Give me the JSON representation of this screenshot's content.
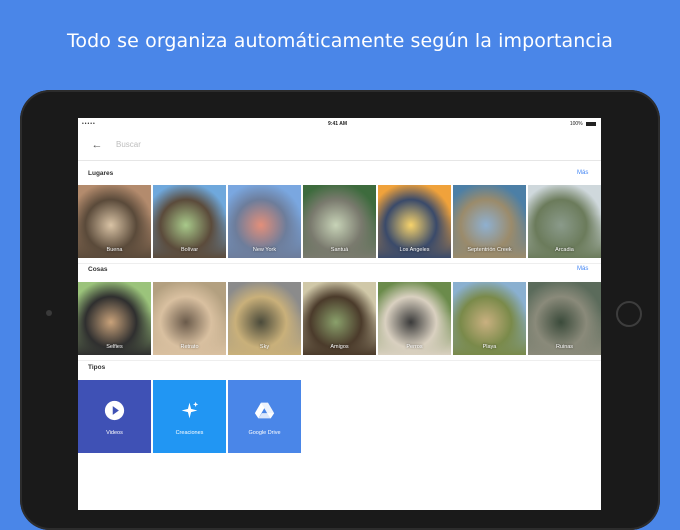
{
  "headline": "Todo se organiza automáticamente según la importancia",
  "status_bar": {
    "signal": "•••••",
    "time": "9:41 AM",
    "battery": "100%"
  },
  "search": {
    "placeholder": "Buscar"
  },
  "sections": {
    "places": {
      "title": "Lugares",
      "more": "Más",
      "items": [
        {
          "label": "Buena",
          "colors": [
            "#b38b6d",
            "#5a4a3a",
            "#d9c3a5"
          ]
        },
        {
          "label": "Bolívar",
          "colors": [
            "#6fa8dc",
            "#5b4b3b",
            "#a8c98a"
          ]
        },
        {
          "label": "New York",
          "colors": [
            "#7aa7e0",
            "#6d7d9b",
            "#e38f7a"
          ]
        },
        {
          "label": "Santuá",
          "colors": [
            "#3d6b3d",
            "#7a7a6e",
            "#c7d3b7"
          ]
        },
        {
          "label": "Los Angeles",
          "colors": [
            "#f0a23b",
            "#3a4a6a",
            "#f7d36b"
          ]
        },
        {
          "label": "Septentrión Creek",
          "colors": [
            "#4c7fa6",
            "#9b8b6b",
            "#8fb0d0"
          ]
        },
        {
          "label": "Arcadia",
          "colors": [
            "#cfd8dc",
            "#6b7b5b",
            "#8a9a8a"
          ]
        }
      ]
    },
    "things": {
      "title": "Cosas",
      "more": "Más",
      "items": [
        {
          "label": "Selfies",
          "colors": [
            "#9bc37b",
            "#2f2f2f",
            "#c9a27a"
          ]
        },
        {
          "label": "Retrato",
          "colors": [
            "#b3a080",
            "#d9c0a0",
            "#6b5b4b"
          ]
        },
        {
          "label": "Sky",
          "colors": [
            "#8b8b8b",
            "#c9b07a",
            "#4b4b3b"
          ]
        },
        {
          "label": "Amigos",
          "colors": [
            "#d0c8a8",
            "#4b3b2b",
            "#8aa06b"
          ]
        },
        {
          "label": "Perros",
          "colors": [
            "#6b8b4b",
            "#d9d0c0",
            "#3b3b3b"
          ]
        },
        {
          "label": "Playa",
          "colors": [
            "#8ab0d0",
            "#7a8a4a",
            "#c9b080"
          ]
        },
        {
          "label": "Ruinas",
          "colors": [
            "#5b6b5b",
            "#8a8a7a",
            "#3b4b3b"
          ]
        }
      ]
    },
    "types": {
      "title": "Tipos",
      "items": [
        {
          "label": "Videos",
          "icon": "play-circle-icon",
          "color": "#3f51b5"
        },
        {
          "label": "Creaciones",
          "icon": "sparkle-icon",
          "color": "#2196f3"
        },
        {
          "label": "Google Drive",
          "icon": "google-drive-icon",
          "color": "#4a86e8"
        }
      ]
    }
  }
}
